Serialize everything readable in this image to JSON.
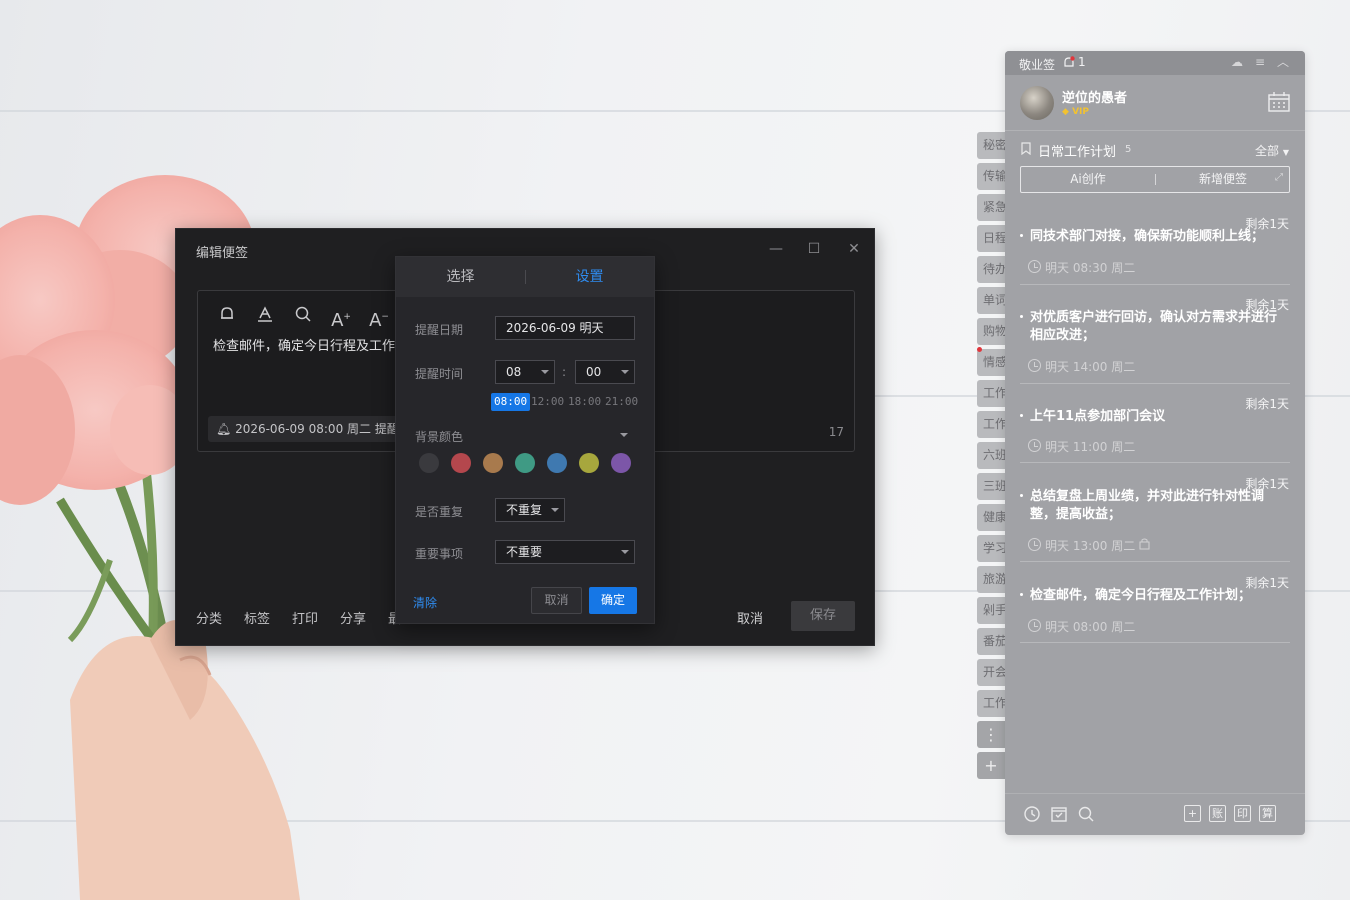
{
  "editor": {
    "title": "编辑便签",
    "note_text": "检查邮件，确定今日行程及工作计划；",
    "reminder_chip": "2026-06-09 08:00 周二 提醒",
    "char_count": "17",
    "toolbar_icons": [
      "bell-icon",
      "font-color-icon",
      "search-icon",
      "font-increase-icon",
      "font-decrease-icon"
    ],
    "bottom_links": [
      "分类",
      "标签",
      "打印",
      "分享",
      "最"
    ],
    "cancel_label": "取消",
    "save_label": "保存"
  },
  "popup": {
    "tabs": [
      "选择",
      "设置"
    ],
    "active_tab": "设置",
    "date_label": "提醒日期",
    "date_value": "2026-06-09 明天",
    "time_label": "提醒时间",
    "hour_value": "08",
    "time_sep": ":",
    "minute_value": "00",
    "quick_times": [
      "08:00",
      "12:00",
      "18:00",
      "21:00"
    ],
    "active_quick_time": "08:00",
    "bg_color_label": "背景颜色",
    "colors": [
      "#3a3a3e",
      "#b4474d",
      "#a87a4d",
      "#3f9a84",
      "#3f79b0",
      "#a7a73d",
      "#7c56a8"
    ],
    "repeat_label": "是否重复",
    "repeat_value": "不重复",
    "importance_label": "重要事项",
    "importance_value": "不重要",
    "clear_label": "清除",
    "cancel_label": "取消",
    "ok_label": "确定"
  },
  "side_tabs": [
    "秘密",
    "传输",
    "紧急",
    "日程",
    "待办",
    "单词",
    "购物",
    "情感",
    "工作",
    "工作",
    "六班",
    "三班",
    "健康",
    "学习",
    "旅游",
    "剁手",
    "番茄",
    "开会",
    "工作"
  ],
  "side_tab_more": "⋮",
  "side_tab_add": "+",
  "panel": {
    "app_name": "敬业签",
    "bell_count": "1",
    "username": "逆位的愚者",
    "vip_label": "VIP",
    "category_title": "日常工作计划",
    "category_count": "5",
    "filter_label": "全部",
    "ai_label": "Ai创作",
    "new_note_label": "新增便签",
    "notes": [
      {
        "remain": "剩余1天",
        "content": "同技术部门对接，确保新功能顺利上线；",
        "time": "明天 08:30 周二"
      },
      {
        "remain": "剩余1天",
        "content": "对优质客户进行回访，确认对方需求并进行相应改进；",
        "time": "明天 14:00 周二"
      },
      {
        "remain": "剩余1天",
        "content": "上午11点参加部门会议",
        "time": "明天 11:00 周二"
      },
      {
        "remain": "剩余1天",
        "content": "总结复盘上周业绩，并对此进行针对性调整，提高收益；",
        "time": "明天 13:00 周二"
      },
      {
        "remain": "剩余1天",
        "content": "检查邮件，确定今日行程及工作计划；",
        "time": "明天 08:00 周二"
      }
    ],
    "footer_boxes": [
      "+",
      "账",
      "印",
      "算"
    ]
  }
}
